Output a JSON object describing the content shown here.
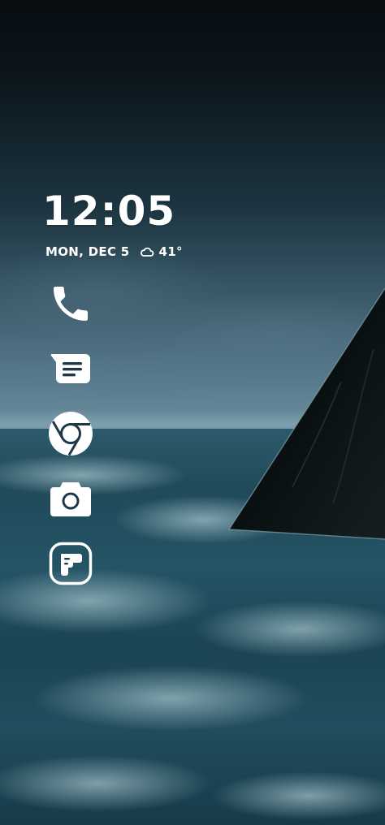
{
  "lockscreen": {
    "time": "12:05",
    "date": "MON, DEC 5",
    "weather": {
      "icon": "cloud-icon",
      "temperature": "41°"
    }
  },
  "apps": [
    {
      "name": "Phone",
      "icon": "phone-icon"
    },
    {
      "name": "Messages",
      "icon": "messages-icon"
    },
    {
      "name": "Chrome",
      "icon": "chrome-icon"
    },
    {
      "name": "Camera",
      "icon": "camera-icon"
    },
    {
      "name": "Notes",
      "icon": "notes-icon"
    }
  ],
  "colors": {
    "icon": "#ffffff",
    "text": "#ffffff",
    "sky_dark": "#080d11",
    "sea": "#1f4a5a",
    "monolith": "#0b1212"
  }
}
